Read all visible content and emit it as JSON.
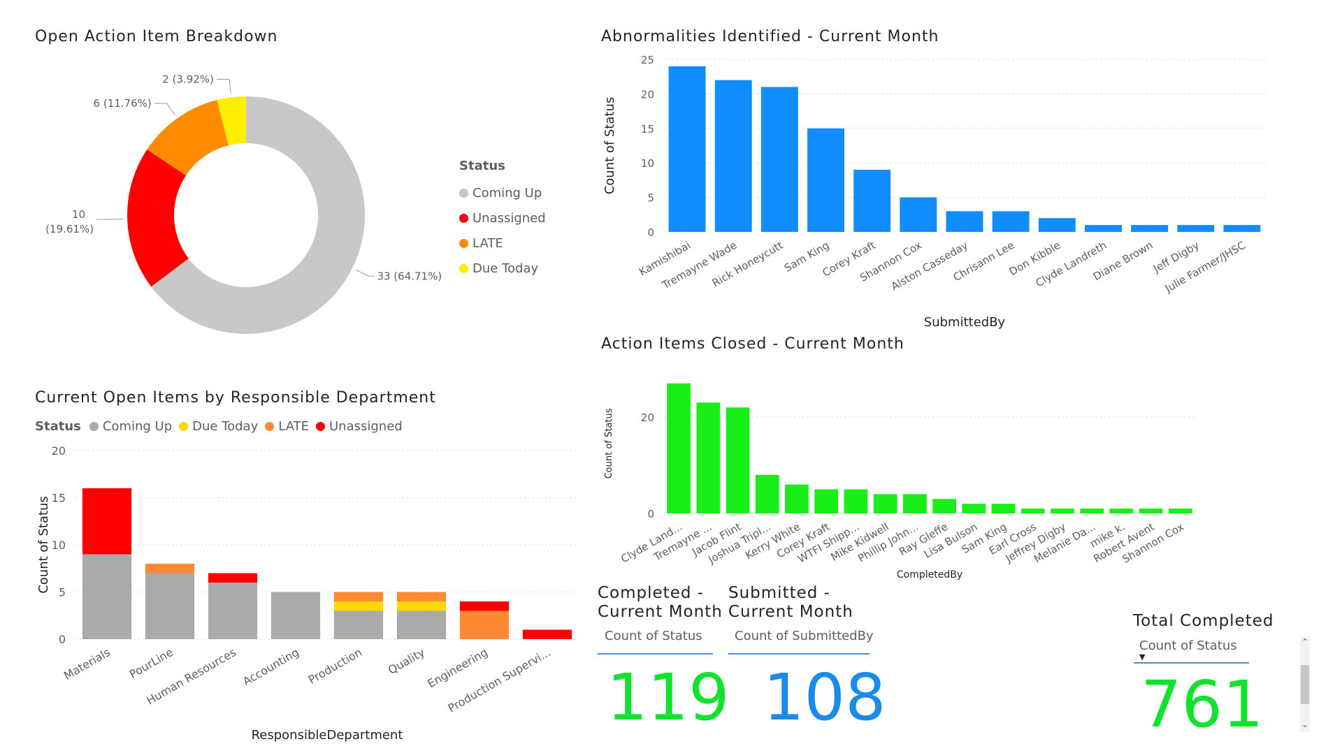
{
  "donut": {
    "title": "Open Action Item Breakdown",
    "legend_title": "Status",
    "slices": [
      {
        "name": "Coming Up",
        "value": 33,
        "label": "33 (64.71%)",
        "color": "#c8c8c8"
      },
      {
        "name": "Unassigned",
        "value": 10,
        "label_line1": "10",
        "label_line2": "(19.61%)",
        "color": "#ff0000"
      },
      {
        "name": "LATE",
        "value": 6,
        "label": "6 (11.76%)",
        "color": "#ff8c00"
      },
      {
        "name": "Due Today",
        "value": 2,
        "label": "2 (3.92%)",
        "color": "#ffee00"
      }
    ]
  },
  "dept": {
    "title": "Current Open Items by Responsible Department",
    "legend_title": "Status",
    "legend": [
      {
        "name": "Coming Up",
        "color": "#aaaaaa"
      },
      {
        "name": "Due Today",
        "color": "#ffd800"
      },
      {
        "name": "LATE",
        "color": "#ff8833"
      },
      {
        "name": "Unassigned",
        "color": "#ff0000"
      }
    ]
  },
  "abnorm": {
    "title": "Abnormalities Identified - Current Month"
  },
  "closed": {
    "title": "Action Items Closed - Current Month"
  },
  "cards": {
    "completed": {
      "title_line1": "Completed -",
      "title_line2": "Current Month",
      "sub": "Count of Status",
      "value": "119",
      "color": "#12e12e"
    },
    "submitted": {
      "title_line1": "Submitted -",
      "title_line2": "Current Month",
      "sub": "Count of SubmittedBy",
      "value": "108",
      "color": "#1a8be8"
    },
    "total": {
      "title": "Total Completed",
      "sub": "Count of Status",
      "sort_icon": "sort-desc-icon",
      "value": "761",
      "color": "#12e12e"
    }
  },
  "chart_data": [
    {
      "type": "pie",
      "title": "Open Action Item Breakdown",
      "categories": [
        "Coming Up",
        "Unassigned",
        "LATE",
        "Due Today"
      ],
      "values": [
        33,
        10,
        6,
        2
      ],
      "legend_title": "Status",
      "legend": "right"
    },
    {
      "type": "bar",
      "stacked": true,
      "title": "Current Open Items by Responsible Department",
      "xlabel": "ResponsibleDepartment",
      "ylabel": "Count of Status",
      "ylim": [
        0,
        20
      ],
      "yticks": [
        0,
        5,
        10,
        15,
        20
      ],
      "categories": [
        "Materials",
        "PourLine",
        "Human Resources",
        "Accounting",
        "Production",
        "Quality",
        "Engineering",
        "Production Supervi..."
      ],
      "series": [
        {
          "name": "Coming Up",
          "values": [
            9,
            7,
            6,
            5,
            3,
            3,
            0,
            0
          ],
          "color": "#aaaaaa"
        },
        {
          "name": "Due Today",
          "values": [
            0,
            0,
            0,
            0,
            1,
            1,
            0,
            0
          ],
          "color": "#ffd800"
        },
        {
          "name": "LATE",
          "values": [
            0,
            1,
            0,
            0,
            1,
            1,
            3,
            0
          ],
          "color": "#ff8833"
        },
        {
          "name": "Unassigned",
          "values": [
            7,
            0,
            1,
            0,
            0,
            0,
            1,
            1
          ],
          "color": "#ff0000"
        }
      ],
      "grid": true,
      "legend": "top-left"
    },
    {
      "type": "bar",
      "title": "Abnormalities Identified - Current Month",
      "xlabel": "SubmittedBy",
      "ylabel": "Count of Status",
      "ylim": [
        0,
        25
      ],
      "yticks": [
        0,
        5,
        10,
        15,
        20,
        25
      ],
      "categories": [
        "Kamishibai",
        "Tremayne Wade",
        "Rick Honeycutt",
        "Sam King",
        "Corey Kraft",
        "Shannon Cox",
        "Alston Casseday",
        "Chrisann Lee",
        "Don Kibble",
        "Clyde Landreth",
        "Diane Brown",
        "Jeff Digby",
        "Julie Farmer/JHSC"
      ],
      "values": [
        24,
        22,
        21,
        15,
        9,
        5,
        3,
        3,
        2,
        1,
        1,
        1,
        1
      ],
      "color": "#118dff",
      "grid": true
    },
    {
      "type": "bar",
      "title": "Action Items Closed - Current Month",
      "xlabel": "CompletedBy",
      "ylabel": "Count of Status",
      "ylim": [
        0,
        29
      ],
      "yticks": [
        0,
        20
      ],
      "categories": [
        "Clyde Land...",
        "Tremayne ...",
        "Jacob Flint",
        "Joshua Tripl...",
        "Kerry White",
        "Corey Kraft",
        "WTFI Shipp...",
        "Mike Kidwell",
        "Phillip John...",
        "Ray Gleffe",
        "Lisa Bulson",
        "Sam King",
        "Earl Cross",
        "Jeffrey Digby",
        "Melanie Da...",
        "mike k.",
        "Robert Avent",
        "Shannon Cox"
      ],
      "values": [
        27,
        23,
        22,
        8,
        6,
        5,
        5,
        4,
        4,
        3,
        2,
        2,
        1,
        1,
        1,
        1,
        1,
        1
      ],
      "color": "#19ee19",
      "grid": true
    }
  ]
}
